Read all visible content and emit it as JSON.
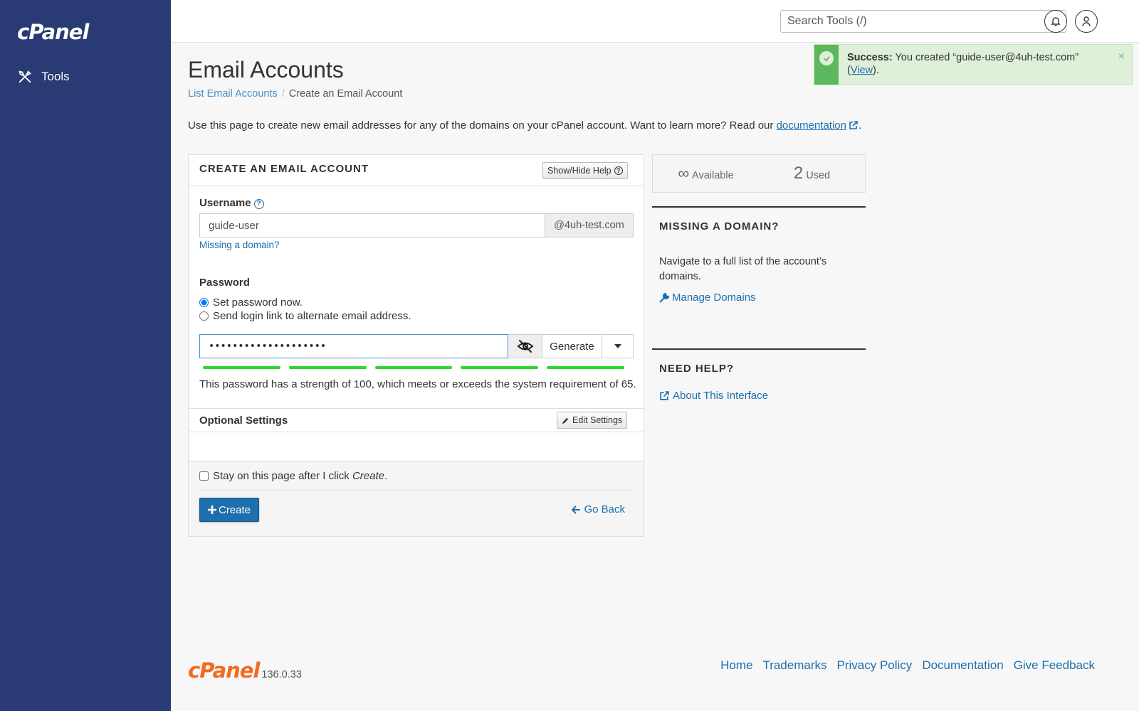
{
  "sidebar": {
    "logo_text": "cPanel",
    "items": [
      {
        "label": "Tools",
        "icon": "tools-icon"
      }
    ]
  },
  "topbar": {
    "search_placeholder": "Search Tools (/)",
    "search_value": ""
  },
  "toast": {
    "title": "Success:",
    "message_prefix": "You created “guide-user@4uh-test.com”",
    "view_open": "(",
    "view_link": "View",
    "view_close": ").",
    "close": "×"
  },
  "main": {
    "title": "Email Accounts",
    "breadcrumb": {
      "parent": "List Email Accounts",
      "separator": "/",
      "current": "Create an Email Account"
    },
    "intro_text": "Use this page to create new email addresses for any of the domains on your cPanel account. Want to learn more? Read our",
    "intro_link": "documentation",
    "intro_end": "."
  },
  "panel": {
    "heading": "CREATE AN EMAIL ACCOUNT",
    "show_hide_help": "Show/Hide Help",
    "username_label": "Username",
    "username_value": "guide-user",
    "domain_addon": "@4uh-test.com",
    "missing_domain_link": "Missing a domain?",
    "password_label": "Password",
    "radio_set_now": "Set password now.",
    "radio_send_link": "Send login link to alternate email address.",
    "password_value": "••••••••••••••••••••",
    "generate_label": "Generate",
    "strength_text": "This password has a strength of 100, which meets or exceeds the system requirement of 65.",
    "optional_settings": "Optional Settings",
    "edit_settings": "Edit Settings",
    "stay_label": "Stay on this page after I click",
    "stay_label_em": "Create",
    "stay_label_end": ".",
    "create_label": "Create",
    "go_back_label": "Go Back"
  },
  "stats": {
    "available_value": "∞",
    "available_label": "Available",
    "used_value": "2",
    "used_label": "Used"
  },
  "missing_domain": {
    "heading": "MISSING A DOMAIN?",
    "text": "Navigate to a full list of the account’s domains.",
    "link": "Manage Domains"
  },
  "need_help": {
    "heading": "NEED HELP?",
    "link": "About This Interface"
  },
  "footer": {
    "logo_text": "cPanel",
    "version": "136.0.33",
    "links": [
      "Home",
      "Trademarks",
      "Privacy Policy",
      "Documentation",
      "Give Feedback"
    ]
  },
  "colors": {
    "sidebar_bg": "#293a74",
    "primary_blue": "#1d6fae",
    "brand_orange": "#f26a21",
    "success_green": "#5cb85c",
    "strength_green": "#2cd62c"
  }
}
